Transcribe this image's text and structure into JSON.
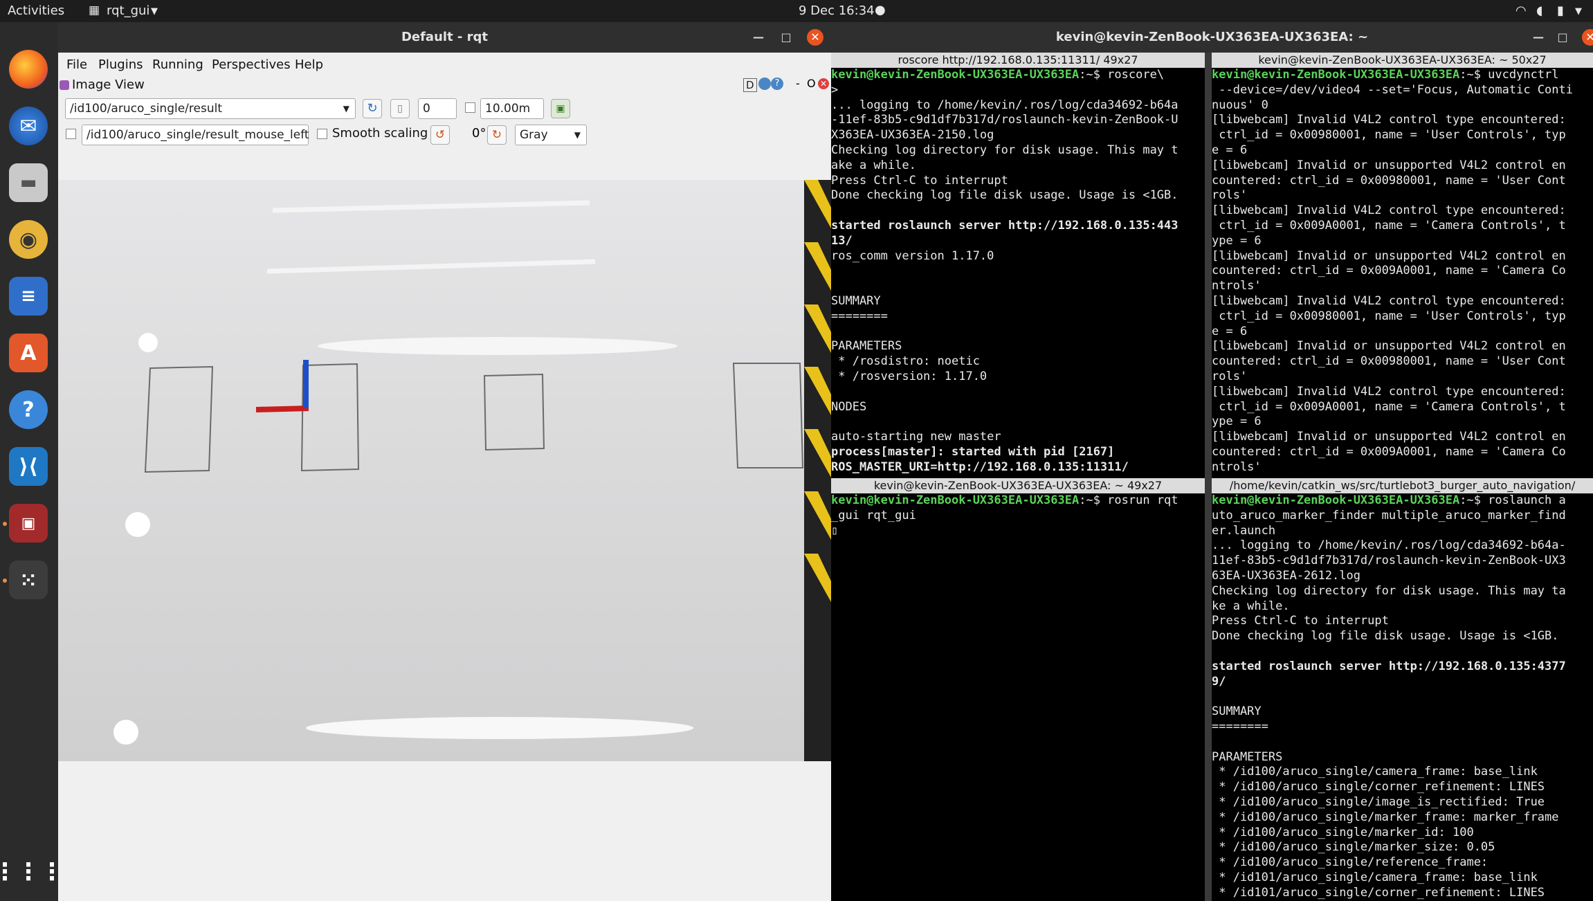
{
  "topbar": {
    "activities": "Activities",
    "app_menu": "rqt_gui",
    "clock": "9 Dec  16:34"
  },
  "rqt": {
    "title": "Default - rqt",
    "menu": [
      "File",
      "Plugins",
      "Running",
      "Perspectives",
      "Help"
    ],
    "plugin_title": "Image View",
    "plugin_buttons": "D",
    "topic": "/id100/aruco_single/result",
    "counter_value": "0",
    "distance_value": "10.00m",
    "mouse_topic": "/id100/aruco_single/result_mouse_left",
    "smooth_scaling": "Smooth scaling",
    "rotation": "0°",
    "color_scheme": "Gray"
  },
  "terminal_window": {
    "title": "kevin@kevin-ZenBook-UX363EA-UX363EA: ~"
  },
  "panes": {
    "tl": {
      "title": "roscore http://192.168.0.135:11311/ 49x27",
      "lines": [
        {
          "p": "kevin@kevin-ZenBook-UX363EA-UX363EA",
          "t": ":~$ roscore\\"
        },
        {
          "t": ">"
        },
        {
          "t": "... logging to /home/kevin/.ros/log/cda34692-b64a"
        },
        {
          "t": "-11ef-83b5-c9d1df7b317d/roslaunch-kevin-ZenBook-U"
        },
        {
          "t": "X363EA-UX363EA-2150.log"
        },
        {
          "t": "Checking log directory for disk usage. This may t"
        },
        {
          "t": "ake a while."
        },
        {
          "t": "Press Ctrl-C to interrupt"
        },
        {
          "t": "Done checking log file disk usage. Usage is <1GB."
        },
        {
          "t": ""
        },
        {
          "b": "started roslaunch server http://192.168.0.135:443"
        },
        {
          "b": "13/"
        },
        {
          "t": "ros_comm version 1.17.0"
        },
        {
          "t": ""
        },
        {
          "t": ""
        },
        {
          "t": "SUMMARY"
        },
        {
          "t": "========"
        },
        {
          "t": ""
        },
        {
          "t": "PARAMETERS"
        },
        {
          "t": " * /rosdistro: noetic"
        },
        {
          "t": " * /rosversion: 1.17.0"
        },
        {
          "t": ""
        },
        {
          "t": "NODES"
        },
        {
          "t": ""
        },
        {
          "t": "auto-starting new master"
        },
        {
          "b": "process[master]: started with pid [2167]"
        },
        {
          "b": "ROS_MASTER_URI=http://192.168.0.135:11311/"
        }
      ]
    },
    "tr": {
      "title": "kevin@kevin-ZenBook-UX363EA-UX363EA: ~ 50x27",
      "lines": [
        {
          "p": "kevin@kevin-ZenBook-UX363EA-UX363EA",
          "t": ":~$ uvcdynctrl"
        },
        {
          "t": " --device=/dev/video4 --set='Focus, Automatic Conti"
        },
        {
          "t": "nuous' 0"
        },
        {
          "t": "[libwebcam] Invalid V4L2 control type encountered:"
        },
        {
          "t": " ctrl_id = 0x00980001, name = 'User Controls', typ"
        },
        {
          "t": "e = 6"
        },
        {
          "t": "[libwebcam] Invalid or unsupported V4L2 control en"
        },
        {
          "t": "countered: ctrl_id = 0x00980001, name = 'User Cont"
        },
        {
          "t": "rols'"
        },
        {
          "t": "[libwebcam] Invalid V4L2 control type encountered:"
        },
        {
          "t": " ctrl_id = 0x009A0001, name = 'Camera Controls', t"
        },
        {
          "t": "ype = 6"
        },
        {
          "t": "[libwebcam] Invalid or unsupported V4L2 control en"
        },
        {
          "t": "countered: ctrl_id = 0x009A0001, name = 'Camera Co"
        },
        {
          "t": "ntrols'"
        },
        {
          "t": "[libwebcam] Invalid V4L2 control type encountered:"
        },
        {
          "t": " ctrl_id = 0x00980001, name = 'User Controls', typ"
        },
        {
          "t": "e = 6"
        },
        {
          "t": "[libwebcam] Invalid or unsupported V4L2 control en"
        },
        {
          "t": "countered: ctrl_id = 0x00980001, name = 'User Cont"
        },
        {
          "t": "rols'"
        },
        {
          "t": "[libwebcam] Invalid V4L2 control type encountered:"
        },
        {
          "t": " ctrl_id = 0x009A0001, name = 'Camera Controls', t"
        },
        {
          "t": "ype = 6"
        },
        {
          "t": "[libwebcam] Invalid or unsupported V4L2 control en"
        },
        {
          "t": "countered: ctrl_id = 0x009A0001, name = 'Camera Co"
        },
        {
          "t": "ntrols'"
        }
      ]
    },
    "bl": {
      "title": "kevin@kevin-ZenBook-UX363EA-UX363EA: ~ 49x27",
      "lines": [
        {
          "p": "kevin@kevin-ZenBook-UX363EA-UX363EA",
          "t": ":~$ rosrun rqt"
        },
        {
          "t": "_gui rqt_gui"
        }
      ]
    },
    "br": {
      "title": "/home/kevin/catkin_ws/src/turtlebot3_burger_auto_navigation/",
      "lines": [
        {
          "p": "kevin@kevin-ZenBook-UX363EA-UX363EA",
          "t": ":~$ roslaunch a"
        },
        {
          "t": "uto_aruco_marker_finder multiple_aruco_marker_find"
        },
        {
          "t": "er.launch"
        },
        {
          "t": "... logging to /home/kevin/.ros/log/cda34692-b64a-"
        },
        {
          "t": "11ef-83b5-c9d1df7b317d/roslaunch-kevin-ZenBook-UX3"
        },
        {
          "t": "63EA-UX363EA-2612.log"
        },
        {
          "t": "Checking log directory for disk usage. This may ta"
        },
        {
          "t": "ke a while."
        },
        {
          "t": "Press Ctrl-C to interrupt"
        },
        {
          "t": "Done checking log file disk usage. Usage is <1GB."
        },
        {
          "t": ""
        },
        {
          "b": "started roslaunch server http://192.168.0.135:4377"
        },
        {
          "b": "9/"
        },
        {
          "t": ""
        },
        {
          "t": "SUMMARY"
        },
        {
          "t": "========"
        },
        {
          "t": ""
        },
        {
          "t": "PARAMETERS"
        },
        {
          "t": " * /id100/aruco_single/camera_frame: base_link"
        },
        {
          "t": " * /id100/aruco_single/corner_refinement: LINES"
        },
        {
          "t": " * /id100/aruco_single/image_is_rectified: True"
        },
        {
          "t": " * /id100/aruco_single/marker_frame: marker_frame"
        },
        {
          "t": " * /id100/aruco_single/marker_id: 100"
        },
        {
          "t": " * /id100/aruco_single/marker_size: 0.05"
        },
        {
          "t": " * /id100/aruco_single/reference_frame:"
        },
        {
          "t": " * /id101/aruco_single/camera_frame: base_link"
        },
        {
          "t": " * /id101/aruco_single/corner_refinement: LINES"
        }
      ]
    }
  }
}
